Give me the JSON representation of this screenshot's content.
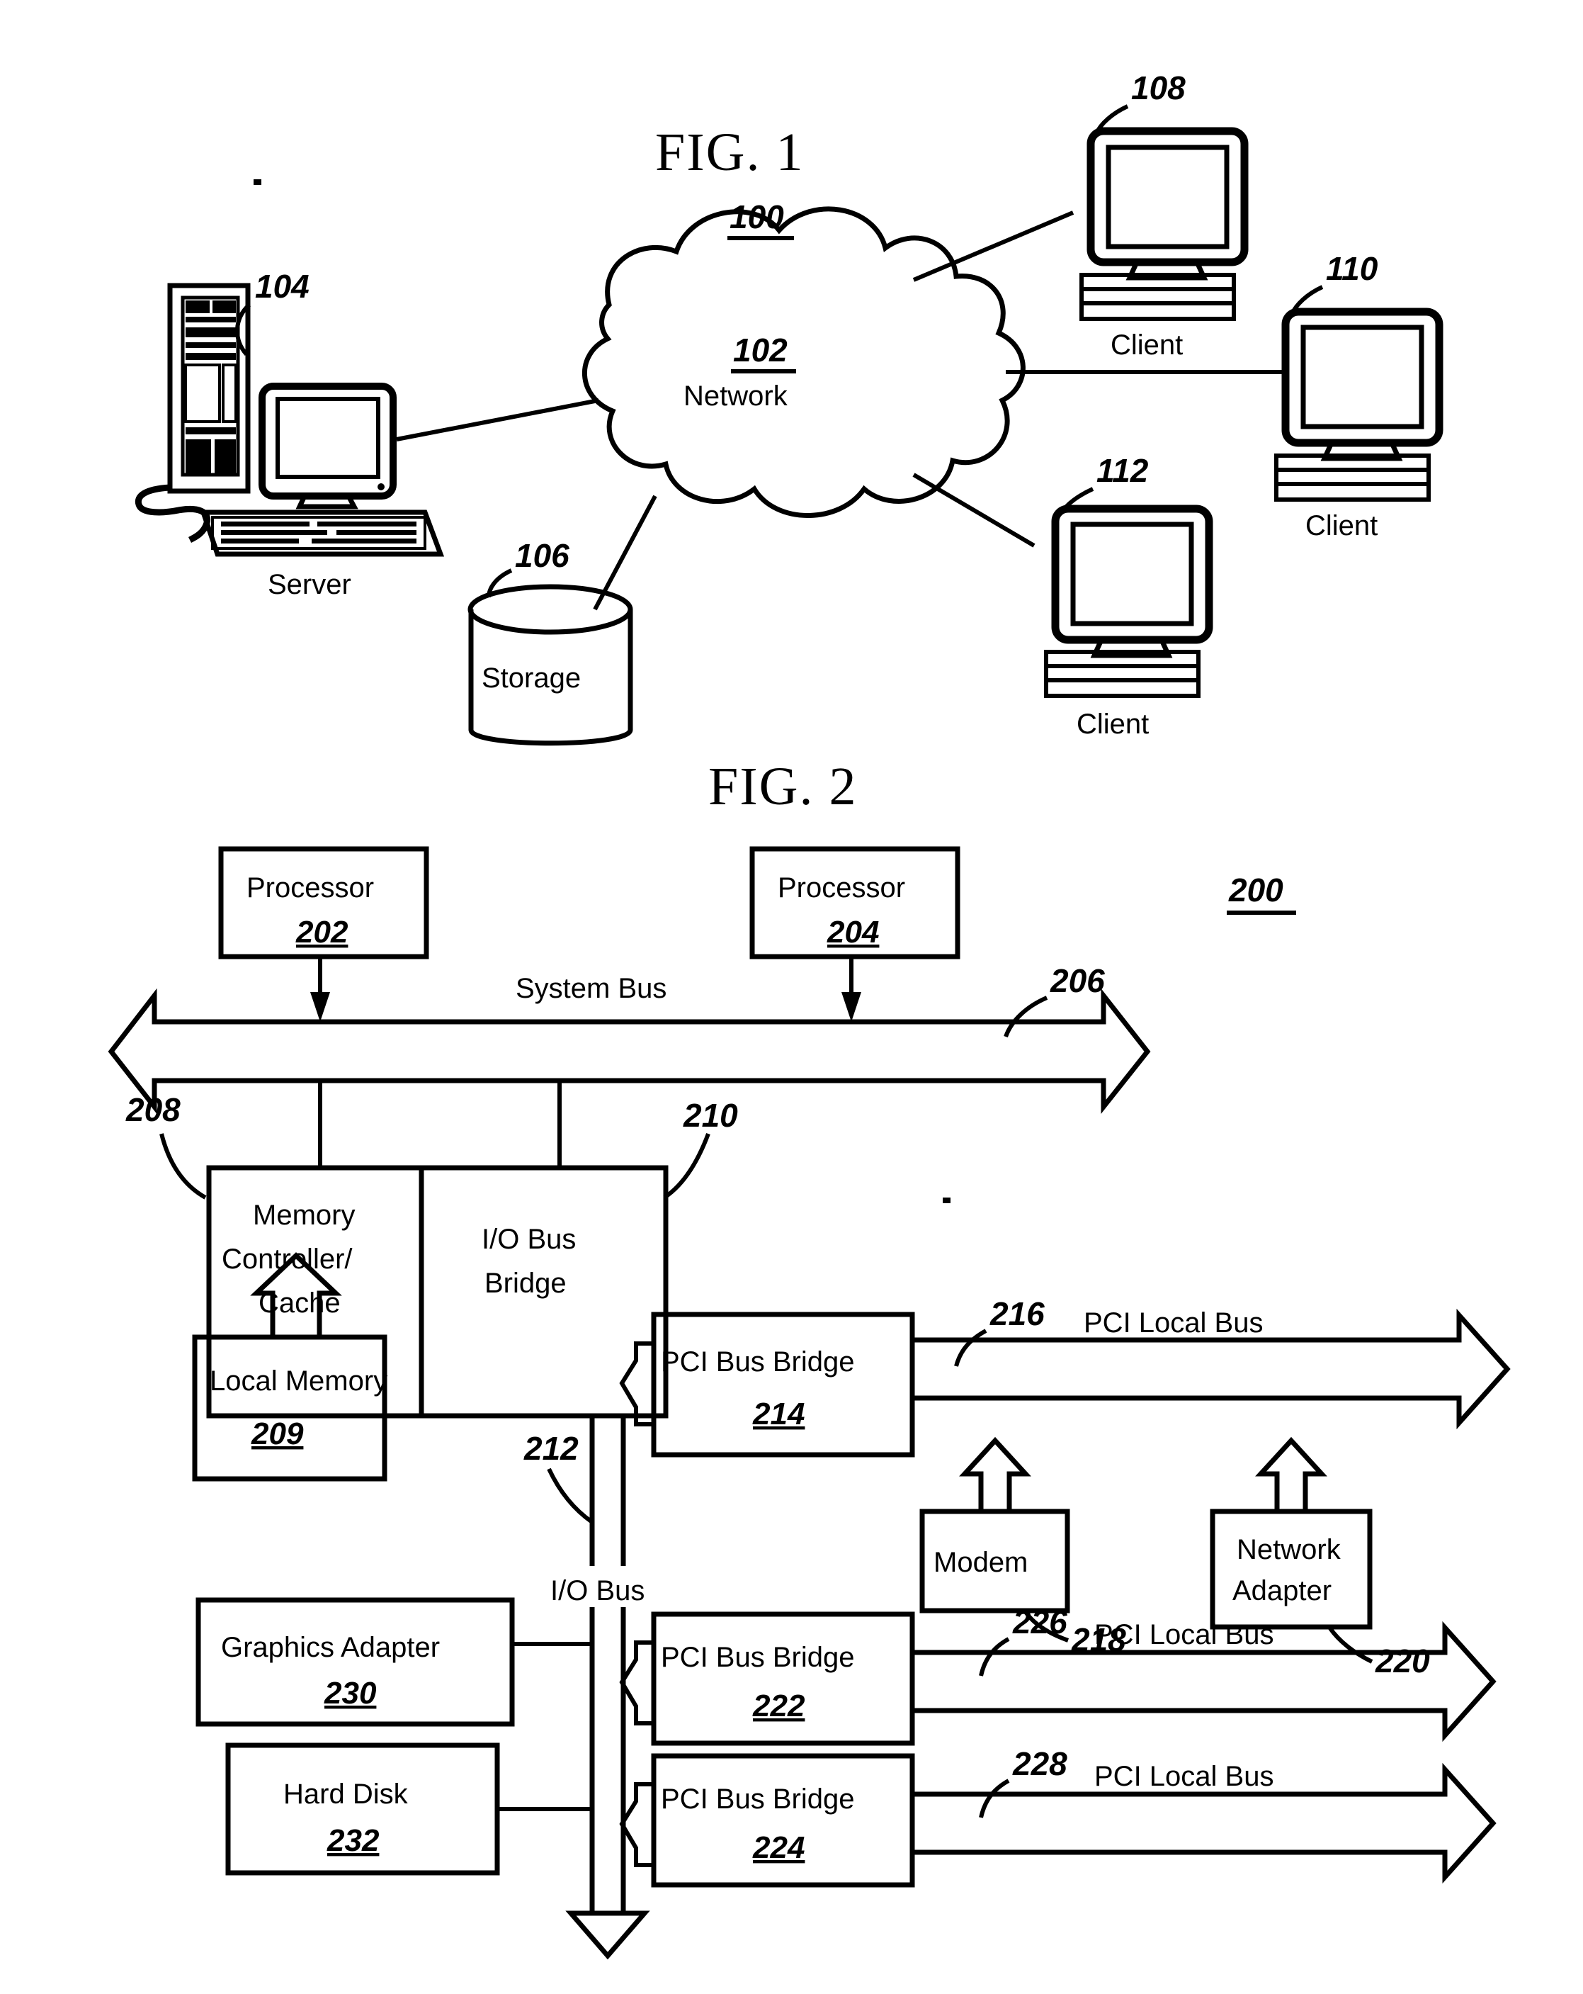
{
  "figures": [
    {
      "id": "fig1",
      "title": "FIG. 1",
      "system_ref": "100",
      "nodes": {
        "network": {
          "ref": "102",
          "label": "Network"
        },
        "server": {
          "ref": "104",
          "label": "Server"
        },
        "storage": {
          "ref": "106",
          "label": "Storage"
        },
        "client_top": {
          "ref": "108",
          "label": "Client"
        },
        "client_right": {
          "ref": "110",
          "label": "Client"
        },
        "client_bottom": {
          "ref": "112",
          "label": "Client"
        }
      }
    },
    {
      "id": "fig2",
      "title": "FIG. 2",
      "system_ref": "200",
      "boxes": {
        "processor_1": {
          "label": "Processor",
          "ref": "202"
        },
        "processor_2": {
          "label": "Processor",
          "ref": "204"
        },
        "memory_controller": {
          "label_line1": "Memory",
          "label_line2": "Controller/",
          "label_line3": "Cache",
          "ref": "208"
        },
        "io_bus_bridge": {
          "label_line1": "I/O Bus",
          "label_line2": "Bridge",
          "ref": "210"
        },
        "local_memory": {
          "label": "Local Memory",
          "ref": "209"
        },
        "pci_bus_bridge_214": {
          "label": "PCI Bus Bridge",
          "ref": "214"
        },
        "pci_bus_bridge_222": {
          "label": "PCI Bus Bridge",
          "ref": "222"
        },
        "pci_bus_bridge_224": {
          "label": "PCI Bus Bridge",
          "ref": "224"
        },
        "modem": {
          "label": "Modem",
          "ref": "218"
        },
        "network_adapter": {
          "label_line1": "Network",
          "label_line2": "Adapter",
          "ref": "220"
        },
        "graphics_adapter": {
          "label": "Graphics Adapter",
          "ref": "230"
        },
        "hard_disk": {
          "label": "Hard Disk",
          "ref": "232"
        }
      },
      "buses": {
        "system_bus": {
          "label": "System Bus",
          "ref": "206"
        },
        "io_bus": {
          "label": "I/O Bus",
          "ref": "212"
        },
        "pci_local_bus_216": {
          "label": "PCI Local Bus",
          "ref": "216"
        },
        "pci_local_bus_226": {
          "label": "PCI Local Bus",
          "ref": "226"
        },
        "pci_local_bus_228": {
          "label": "PCI Local Bus",
          "ref": "228"
        }
      }
    }
  ],
  "colors": {
    "ink": "#000000",
    "paper": "#ffffff"
  }
}
